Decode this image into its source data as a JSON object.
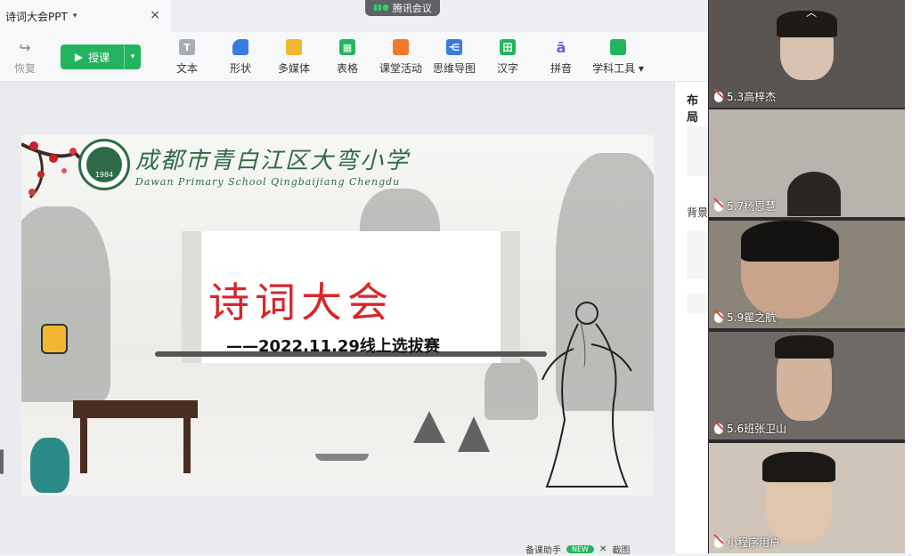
{
  "tab": {
    "title": "诗词大会PPT",
    "caret": "▾",
    "close": "×"
  },
  "meeting": {
    "label": "腾讯会议"
  },
  "toolbar": {
    "undo": "恢复",
    "play": "授课",
    "tools": [
      "文本",
      "形状",
      "多媒体",
      "表格",
      "课堂活动",
      "思维导图",
      "汉字",
      "拼音",
      "学科工具"
    ]
  },
  "side_panel": {
    "layout": "布局",
    "background": "背景"
  },
  "slide": {
    "school_name": "成都市青白江区大弯小学",
    "school_en": "Dawan Primary School Qingbaijiang Chengdu",
    "logo_year": "1984",
    "title": "诗词大会",
    "subtitle": "——2022.11.29线上选拔赛"
  },
  "participants": [
    {
      "name": "5.3高梓杰"
    },
    {
      "name": "5.7杨恩慧"
    },
    {
      "name": "5.9瞿之航"
    },
    {
      "name": "5.6班张卫山"
    },
    {
      "name": "小程序用户"
    }
  ],
  "bottom": {
    "assistant": "备课助手",
    "screenshot": "截图"
  },
  "colors": {
    "accent": "#23b45e",
    "title_red": "#d8262a",
    "school_green": "#2f6b46"
  }
}
